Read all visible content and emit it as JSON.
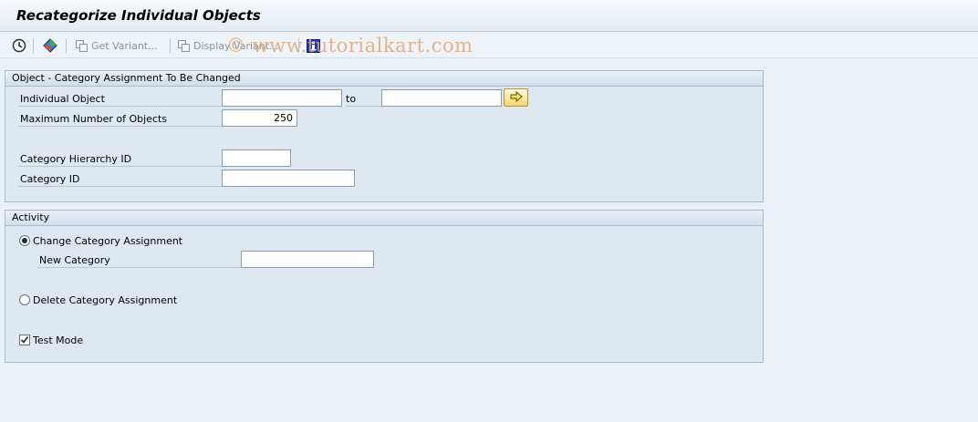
{
  "window": {
    "title": "Recategorize Individual Objects"
  },
  "toolbar": {
    "execute_icon": "execute-clock-icon",
    "variants_icon": "get-variants-icon",
    "get_variant_label": "Get Variant...",
    "display_variant_label": "Display Variant...",
    "info_icon": "info-icon"
  },
  "watermark": "© www.tutorialkart.com",
  "object_group": {
    "header": "Object - Category Assignment To Be Changed",
    "individual_object_label": "Individual Object",
    "individual_object_from": "",
    "to_label": "to",
    "individual_object_to": "",
    "max_objects_label": "Maximum Number of Objects",
    "max_objects_value": "250",
    "category_hierarchy_label": "Category Hierarchy ID",
    "category_hierarchy_value": "",
    "category_id_label": "Category ID",
    "category_id_value": ""
  },
  "activity_group": {
    "header": "Activity",
    "change_label": "Change Category Assignment",
    "change_selected": true,
    "new_category_label": "New Category",
    "new_category_value": "",
    "delete_label": "Delete Category Assignment",
    "delete_selected": false,
    "test_mode_label": "Test Mode",
    "test_mode_checked": true
  },
  "colors": {
    "background": "#eaf0f6",
    "group_background": "#dfe8f1",
    "watermark": "#e8a673"
  }
}
